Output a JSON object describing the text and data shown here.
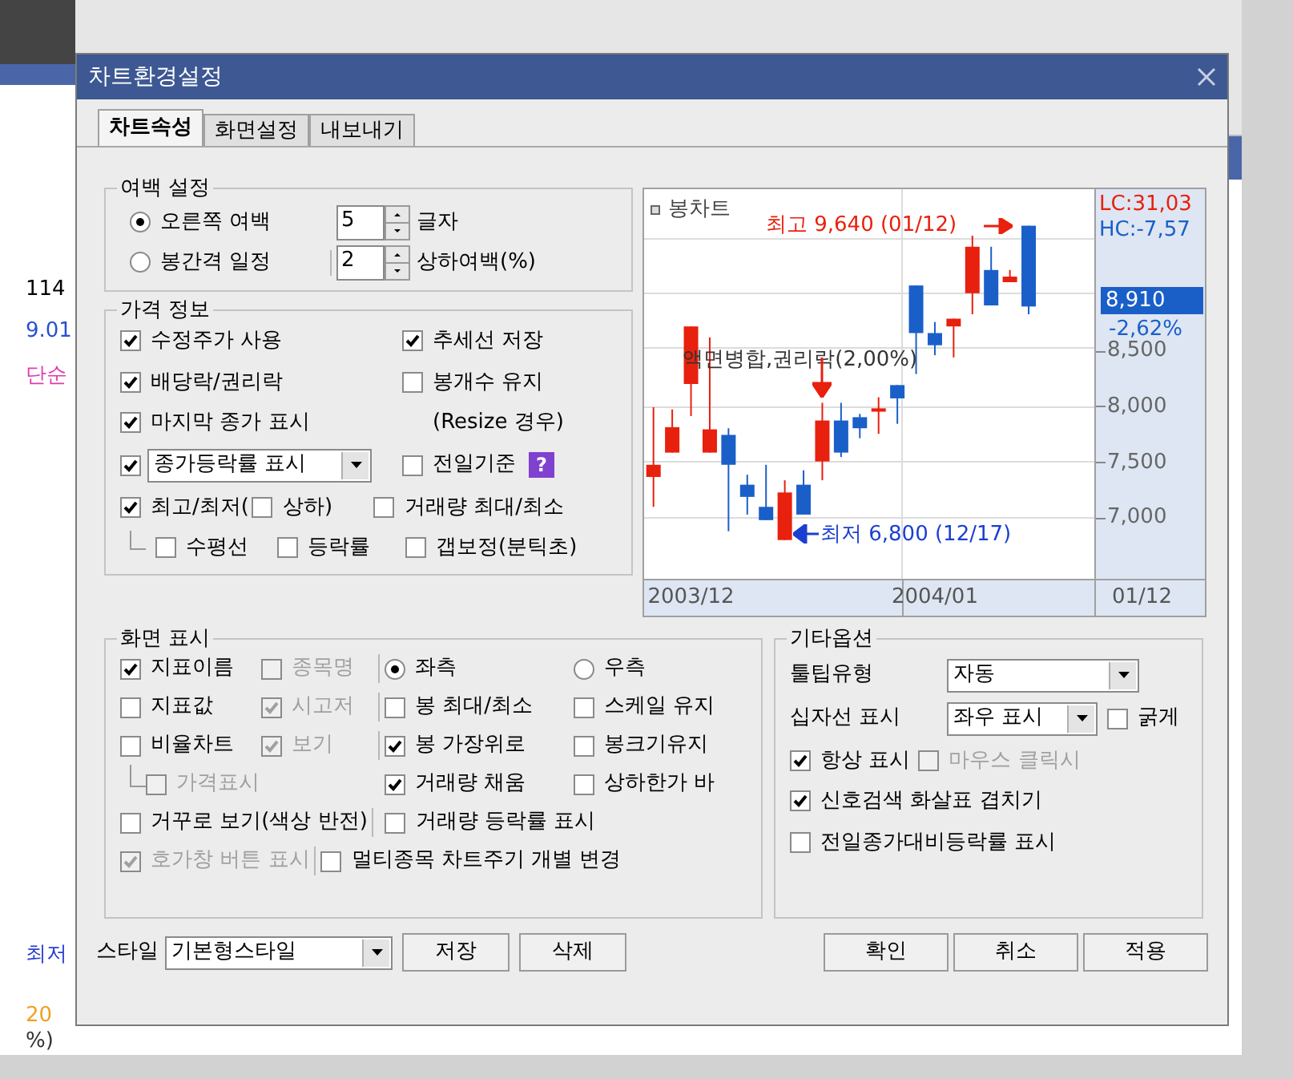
{
  "background": {
    "fragments": [
      {
        "text": "114",
        "color": "#000000"
      },
      {
        "text": "9.01",
        "color": "#2a4fd0"
      },
      {
        "text": "단순",
        "color": "#e03cb0"
      },
      {
        "text": "최저",
        "color": "#2a3fd0"
      },
      {
        "text": "20",
        "color": "#f0a020"
      },
      {
        "text": "%)",
        "color": "#333333"
      }
    ]
  },
  "dialog": {
    "title": "차트환경설정",
    "tabs": [
      {
        "label": "차트속성",
        "selected": true
      },
      {
        "label": "화면설정",
        "selected": false
      },
      {
        "label": "내보내기",
        "selected": false
      }
    ],
    "margin_group": {
      "title": "여백 설정",
      "rows": [
        {
          "label": "오른쪽 여백",
          "selected": true,
          "value": "5",
          "unit": "글자"
        },
        {
          "label": "봉간격 일정",
          "selected": false,
          "value": "2",
          "unit": "상하여백(%)"
        }
      ]
    },
    "price_group": {
      "title": "가격 정보",
      "rows": [
        {
          "items": [
            {
              "kind": "checkbox",
              "label": "수정주가 사용",
              "checked": true
            },
            {
              "kind": "checkbox",
              "label": "추세선 저장",
              "checked": true
            }
          ]
        },
        {
          "items": [
            {
              "kind": "checkbox",
              "label": "배당락/권리락",
              "checked": true
            },
            {
              "kind": "checkbox",
              "label": "봉개수 유지",
              "checked": false
            }
          ]
        },
        {
          "items": [
            {
              "kind": "checkbox",
              "label": "마지막 종가 표시",
              "checked": true
            },
            {
              "kind": "note",
              "label": "(Resize 경우)"
            }
          ]
        },
        {
          "items": [
            {
              "kind": "check_select",
              "value": "종가등락률 표시",
              "checked": true
            },
            {
              "kind": "checkbox",
              "label": "전일기준",
              "checked": false
            },
            {
              "kind": "help",
              "label": "?"
            }
          ]
        },
        {
          "items": [
            {
              "kind": "checkbox",
              "label": "최고/최저(",
              "checked": true
            },
            {
              "kind": "checkbox",
              "label": "상하)",
              "checked": false
            },
            {
              "kind": "checkbox",
              "label": "거래량 최대/최소",
              "checked": false
            }
          ],
          "children": [
            {
              "kind": "checkbox",
              "label": "수평선",
              "checked": false
            },
            {
              "kind": "checkbox",
              "label": "등락률",
              "checked": false
            },
            {
              "kind": "checkbox",
              "label": "갭보정(분틱초)",
              "checked": false
            }
          ]
        }
      ]
    },
    "chart": {
      "title": "봉차트",
      "lc": "LC:31,03",
      "hc": "HC:-7,57",
      "high": "최고 9,640 (01/12)",
      "low": "최저 6,800 (12/17)",
      "event": "액면병합,권리락(2,00%)",
      "price": "8,910",
      "change": "-2,62%",
      "last_date": "01/12",
      "chart_data": {
        "type": "candlestick",
        "categories": [
          null,
          null,
          "2003/12",
          null,
          null,
          null,
          null,
          null,
          null,
          null,
          null,
          null,
          null,
          null,
          null,
          "2004/01",
          null,
          null,
          null,
          null,
          null,
          null,
          null,
          null
        ],
        "ohlc": [
          [
            7370,
            8000,
            7100,
            7480
          ],
          [
            7590,
            7980,
            7590,
            7820
          ],
          [
            8210,
            8730,
            7920,
            8730
          ],
          [
            7590,
            8630,
            7590,
            7800
          ],
          [
            7750,
            7810,
            6880,
            7480
          ],
          [
            7300,
            7390,
            7030,
            7190
          ],
          [
            7100,
            7480,
            6980,
            6980
          ],
          [
            6800,
            7340,
            6800,
            7230
          ],
          [
            7300,
            7430,
            7030,
            7030
          ],
          [
            7510,
            8040,
            7340,
            7880
          ],
          [
            7880,
            8040,
            7550,
            7590
          ],
          [
            7910,
            7940,
            7720,
            7810
          ],
          [
            7960,
            8090,
            7760,
            7990
          ],
          [
            8200,
            8200,
            7850,
            8080
          ],
          [
            9100,
            9100,
            8300,
            8670
          ],
          [
            8670,
            8770,
            8470,
            8560
          ],
          [
            8730,
            8800,
            8450,
            8800
          ],
          [
            9030,
            9550,
            8840,
            9450
          ],
          [
            9240,
            9450,
            8920,
            8920
          ],
          [
            9130,
            9240,
            9130,
            9180
          ],
          [
            9640,
            9640,
            8840,
            8910
          ],
          null,
          null,
          null
        ],
        "ylim": [
          6450,
          9970
        ],
        "grid": true,
        "yticks": [
          {
            "value": 8500,
            "label": "8,500"
          },
          {
            "value": 8000,
            "label": "8,000"
          },
          {
            "value": 7500,
            "label": "7,500"
          },
          {
            "value": 7000,
            "label": "7,000"
          }
        ]
      }
    },
    "display_group": {
      "title": "화면 표시",
      "rows": [
        {
          "left": [
            {
              "kind": "checkbox",
              "label": "지표이름",
              "checked": true,
              "disabled": false
            },
            {
              "kind": "checkbox",
              "label": "종목명",
              "checked": false,
              "disabled": true
            }
          ],
          "right": [
            {
              "kind": "radio",
              "label": "좌측",
              "selected": true
            },
            {
              "kind": "radio",
              "label": "우측",
              "selected": false
            }
          ]
        },
        {
          "left": [
            {
              "kind": "checkbox",
              "label": "지표값",
              "checked": false,
              "disabled": false
            },
            {
              "kind": "checkbox",
              "label": "시고저",
              "checked": true,
              "disabled": true
            }
          ],
          "right": [
            {
              "kind": "checkbox",
              "label": "봉 최대/최소",
              "checked": false,
              "disabled": false
            },
            {
              "kind": "checkbox",
              "label": "스케일 유지",
              "checked": false,
              "disabled": false
            }
          ]
        },
        {
          "left": [
            {
              "kind": "checkbox",
              "label": "비율차트",
              "checked": false,
              "disabled": false
            },
            {
              "kind": "checkbox",
              "label": "보기",
              "checked": true,
              "disabled": true
            }
          ],
          "right": [
            {
              "kind": "checkbox",
              "label": "봉 가장위로",
              "checked": true,
              "disabled": false
            },
            {
              "kind": "checkbox",
              "label": "봉크기유지",
              "checked": false,
              "disabled": false
            }
          ]
        },
        {
          "left": [
            {
              "kind": "branch"
            },
            {
              "kind": "checkbox",
              "label": "가격표시",
              "checked": false,
              "disabled": true
            }
          ],
          "right": [
            {
              "kind": "checkbox",
              "label": "거래량 채움",
              "checked": true,
              "disabled": false
            },
            {
              "kind": "checkbox",
              "label": "상하한가 바",
              "checked": false,
              "disabled": false
            }
          ]
        },
        {
          "left": [
            {
              "kind": "checkbox",
              "label": "거꾸로 보기(색상 반전)",
              "checked": false,
              "disabled": false
            }
          ],
          "right": [
            {
              "kind": "checkbox",
              "label": "거래량 등락률 표시",
              "checked": false,
              "disabled": false
            }
          ]
        },
        {
          "left": [
            {
              "kind": "checkbox",
              "label": "호가창 버튼 표시",
              "checked": true,
              "disabled": true
            }
          ],
          "right": [
            {
              "kind": "checkbox",
              "label": "멀티종목 차트주기 개별 변경",
              "checked": false,
              "disabled": false
            }
          ]
        }
      ]
    },
    "other_group": {
      "title": "기타옵션",
      "tooltip": {
        "label": "툴팁유형",
        "value": "자동"
      },
      "crosshair": {
        "label": "십자선 표시",
        "value": "좌우 표시",
        "bold": {
          "label": "굵게",
          "checked": false
        }
      },
      "checks": [
        [
          {
            "label": "항상 표시",
            "checked": true,
            "disabled": false
          },
          {
            "label": "마우스 클릭시",
            "checked": false,
            "disabled": true
          }
        ],
        [
          {
            "label": "신호검색 화살표 겹치기",
            "checked": true,
            "disabled": false
          }
        ],
        [
          {
            "label": "전일종가대비등락률 표시",
            "checked": false,
            "disabled": false
          }
        ]
      ]
    },
    "style": {
      "label": "스타일",
      "value": "기본형스타일",
      "buttons": [
        "저장",
        "삭제"
      ]
    },
    "buttons": [
      "확인",
      "취소",
      "적용"
    ]
  }
}
